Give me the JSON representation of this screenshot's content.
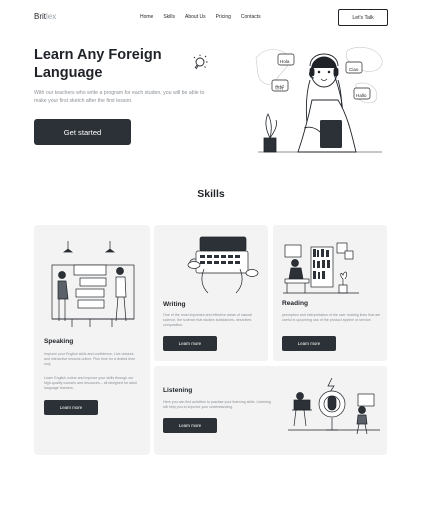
{
  "nav": {
    "logo_bold": "Brit",
    "logo_light": "lex",
    "links": [
      "Home",
      "Skills",
      "About Us",
      "Pricing",
      "Contacts"
    ],
    "cta_label": "Let's Talk"
  },
  "hero": {
    "title": "Learn Any Foreign Language",
    "subtitle": "With our teachers who write a program for each studen, you will be able to make your first sketch after the first lesson.",
    "button_label": "Get started",
    "bubbles": [
      "Hola",
      "Ciao",
      "Hallo",
      "你好"
    ]
  },
  "skills": {
    "title": "Skills",
    "speaking": {
      "title": "Speaking",
      "text1": "Improve your English skills and confidence, Live classes and interactive lessons online. Pick time for a limited time only.",
      "text2": "Learn English online and improve your skills through our high-quality courses and resources – all designed for adult language learners.",
      "button": "Learn more"
    },
    "writing": {
      "title": "Writing",
      "text": "One of the most important and effective areas of natural science, the science that studies substances, describes composition.",
      "button": "Learn more"
    },
    "reading": {
      "title": "Reading",
      "text": "perception and interpretation of the user reading lines that are useful in upcoming use of the product system of service.",
      "button": "Learn more"
    },
    "listening": {
      "title": "Listening",
      "text": "Here you can find activities to practise your listening skills. Listening will help you to improve your understanding.",
      "button": "Learn more"
    }
  }
}
